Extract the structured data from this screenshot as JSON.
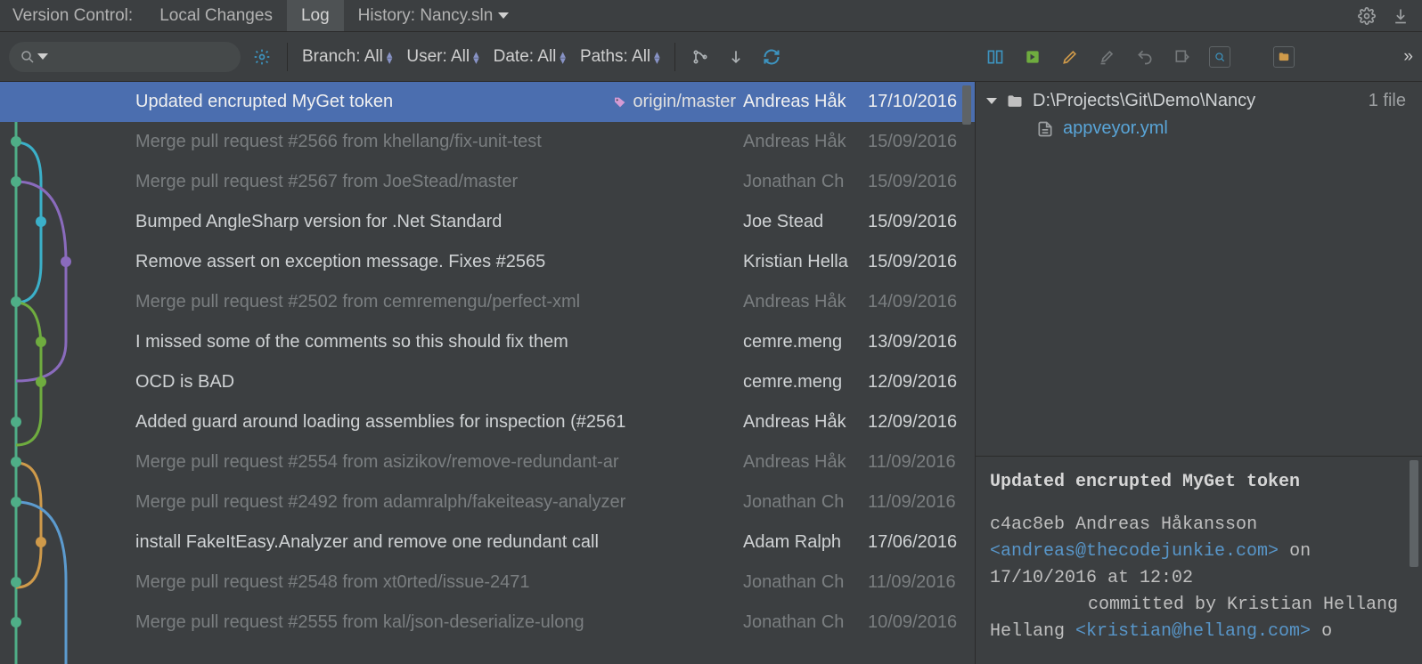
{
  "header": {
    "panel_label": "Version Control:",
    "tabs": [
      {
        "label": "Local Changes",
        "active": false
      },
      {
        "label": "Log",
        "active": true
      },
      {
        "label": "History: Nancy.sln",
        "active": false,
        "has_dropdown": true
      }
    ]
  },
  "toolbar": {
    "filters": {
      "branch_label": "Branch: All",
      "user_label": "User: All",
      "date_label": "Date: All",
      "paths_label": "Paths: All"
    },
    "more_label": "»"
  },
  "commits": [
    {
      "msg": "Updated encrupted MyGet token",
      "author": "Andreas Håk",
      "date": "17/10/2016",
      "selected": true,
      "dim": false,
      "branch": "origin/master"
    },
    {
      "msg": "Merge pull request #2566 from khellang/fix-unit-test",
      "author": "Andreas Håk",
      "date": "15/09/2016",
      "selected": false,
      "dim": true
    },
    {
      "msg": "Merge pull request #2567 from JoeStead/master",
      "author": "Jonathan Ch",
      "date": "15/09/2016",
      "selected": false,
      "dim": true
    },
    {
      "msg": "Bumped AngleSharp version for .Net Standard",
      "author": "Joe Stead",
      "date": "15/09/2016",
      "selected": false,
      "dim": false
    },
    {
      "msg": "Remove assert on exception message. Fixes #2565",
      "author": "Kristian Hella",
      "date": "15/09/2016",
      "selected": false,
      "dim": false
    },
    {
      "msg": "Merge pull request #2502 from cemremengu/perfect-xml",
      "author": "Andreas Håk",
      "date": "14/09/2016",
      "selected": false,
      "dim": true
    },
    {
      "msg": "I missed some of the comments so this should fix them",
      "author": "cemre.meng",
      "date": "13/09/2016",
      "selected": false,
      "dim": false
    },
    {
      "msg": "OCD is BAD",
      "author": "cemre.meng",
      "date": "12/09/2016",
      "selected": false,
      "dim": false
    },
    {
      "msg": "Added guard around loading assemblies for inspection (#2561",
      "author": "Andreas Håk",
      "date": "12/09/2016",
      "selected": false,
      "dim": false
    },
    {
      "msg": "Merge pull request #2554 from asizikov/remove-redundant-ar",
      "author": "Andreas Håk",
      "date": "11/09/2016",
      "selected": false,
      "dim": true
    },
    {
      "msg": "Merge pull request #2492 from adamralph/fakeiteasy-analyzer",
      "author": "Jonathan Ch",
      "date": "11/09/2016",
      "selected": false,
      "dim": true
    },
    {
      "msg": "install FakeItEasy.Analyzer and remove one redundant call",
      "author": "Adam Ralph",
      "date": "17/06/2016",
      "selected": false,
      "dim": false
    },
    {
      "msg": "Merge pull request #2548 from xt0rted/issue-2471",
      "author": "Jonathan Ch",
      "date": "11/09/2016",
      "selected": false,
      "dim": true
    },
    {
      "msg": "Merge pull request #2555 from kal/json-deserialize-ulong",
      "author": "Jonathan Ch",
      "date": "10/09/2016",
      "selected": false,
      "dim": true
    }
  ],
  "files": {
    "root_path": "D:\\Projects\\Git\\Demo\\Nancy",
    "count_label": "1 file",
    "file1": "appveyor.yml"
  },
  "detail": {
    "title": "Updated encrupted MyGet token",
    "hash": "c4ac8eb",
    "author_name": "Andreas Håkansson",
    "author_email": "<andreas@thecodejunkie.com>",
    "on_word": "on",
    "datetime": "17/10/2016 at 12:02",
    "committed_by": "committed by Kristian Hellang",
    "committer_email": "<kristian@hellang.com>",
    "trail": " o"
  },
  "right_toolbar": {
    "more_label": "»"
  }
}
